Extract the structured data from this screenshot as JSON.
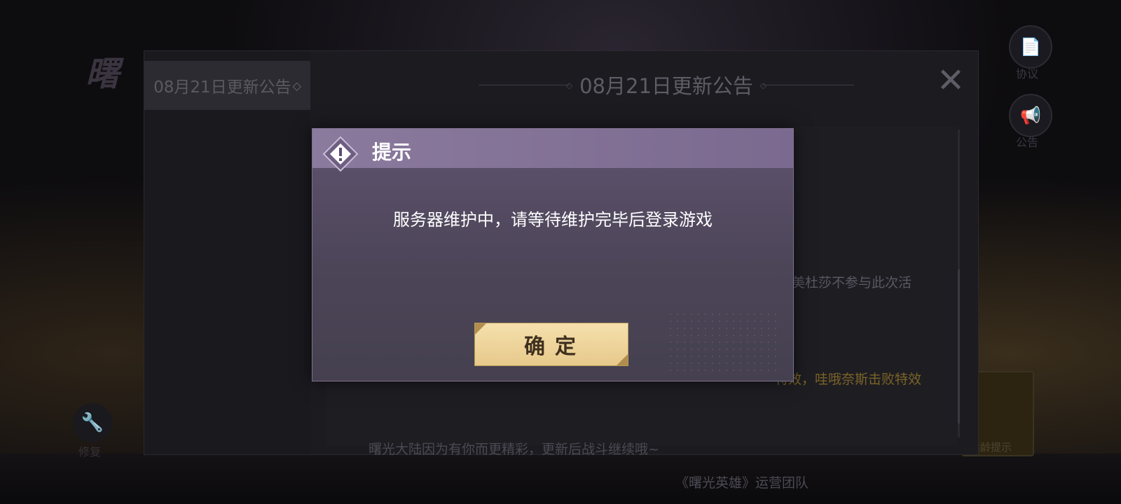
{
  "background": {
    "logo_text": "曙",
    "side_icons": [
      {
        "icon": "protocol-icon",
        "label": "协议"
      },
      {
        "icon": "megaphone-icon",
        "label": "公告"
      }
    ],
    "repair_label": "修复",
    "age_tip_label": "适龄提示"
  },
  "notice": {
    "tab_label": "08月21日更新公告",
    "title": "08月21日更新公告",
    "close_icon": "close-icon",
    "lines": [
      {
        "text": "与美杜莎不参与此次活",
        "color": "#5a5864"
      },
      {
        "text": "特效，哇哦奈斯击败特效",
        "color": "#7b6428"
      },
      {
        "text": "曙光大陆因为有你而更精彩，更新后战斗继续哦~",
        "color": "#4b4a53"
      },
      {
        "text": "《曙光英雄》运营团队",
        "color": "#4b4a53"
      }
    ]
  },
  "dialog": {
    "icon": "warning-diamond-icon",
    "title": "提示",
    "message": "服务器维护中，请等待维护完毕后登录游戏",
    "confirm_label": "确定"
  }
}
